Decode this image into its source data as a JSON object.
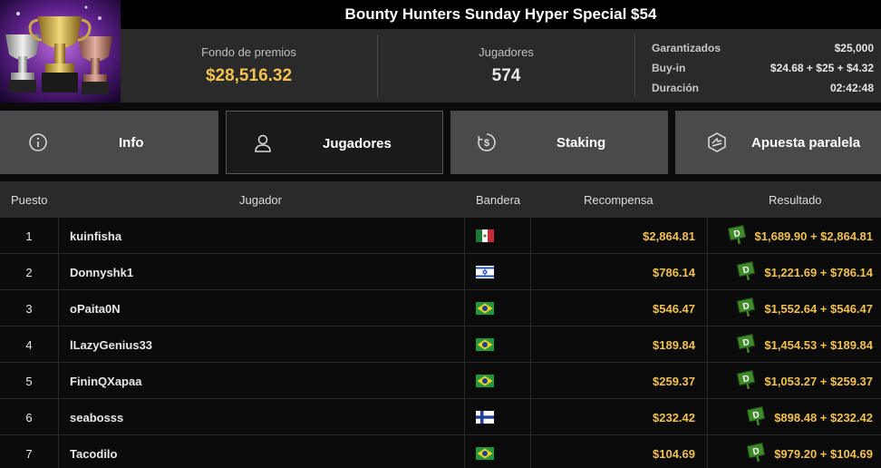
{
  "header": {
    "title": "Bounty Hunters Sunday Hyper Special $54",
    "thumbnail_icon": "trophies-image"
  },
  "stats": {
    "prize_pool": {
      "label": "Fondo de premios",
      "value": "$28,516.32",
      "color": "#f2c14e"
    },
    "players": {
      "label": "Jugadores",
      "value": "574"
    },
    "details": [
      {
        "label": "Garantizados",
        "value": "$25,000"
      },
      {
        "label": "Buy-in",
        "value": "$24.68 + $25 + $4.32"
      },
      {
        "label": "Duración",
        "value": "02:42:48"
      }
    ]
  },
  "tabs": [
    {
      "label": "Info",
      "icon": "info-icon",
      "active": false
    },
    {
      "label": "Jugadores",
      "icon": "user-icon",
      "active": true
    },
    {
      "label": "Staking",
      "icon": "dollar-coin-icon",
      "active": false
    },
    {
      "label": "Apuesta paralela",
      "icon": "side-bet-icon",
      "active": false
    }
  ],
  "table": {
    "headers": [
      "Puesto",
      "Jugador",
      "Bandera",
      "Recompensa",
      "Resultado"
    ],
    "rows": [
      {
        "pos": "1",
        "player": "kuinfisha",
        "flag": "mexico-flag",
        "reward": "$2,864.81",
        "badge": "D",
        "result": "$1,689.90 + $2,864.81"
      },
      {
        "pos": "2",
        "player": "Donnyshk1",
        "flag": "israel-flag",
        "reward": "$786.14",
        "badge": "D",
        "result": "$1,221.69 + $786.14"
      },
      {
        "pos": "3",
        "player": "oPaita0N",
        "flag": "brazil-flag",
        "reward": "$546.47",
        "badge": "D",
        "result": "$1,552.64 + $546.47"
      },
      {
        "pos": "4",
        "player": "lLazyGenius33",
        "flag": "brazil-flag",
        "reward": "$189.84",
        "badge": "D",
        "result": "$1,454.53 + $189.84"
      },
      {
        "pos": "5",
        "player": "FininQXapaa",
        "flag": "brazil-flag",
        "reward": "$259.37",
        "badge": "D",
        "result": "$1,053.27 + $259.37"
      },
      {
        "pos": "6",
        "player": "seabosss",
        "flag": "finland-flag",
        "reward": "$232.42",
        "badge": "D",
        "result": "$898.48 + $232.42"
      },
      {
        "pos": "7",
        "player": "Tacodilo",
        "flag": "brazil-flag",
        "reward": "$104.69",
        "badge": "D",
        "result": "$979.20 + $104.69"
      }
    ]
  },
  "colors": {
    "accent_gold": "#f2c14e",
    "badge_green": "#3f8a2a"
  }
}
